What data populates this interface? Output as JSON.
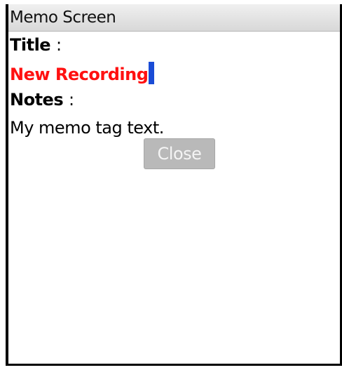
{
  "window": {
    "title": "Memo Screen"
  },
  "form": {
    "title_label": "Title",
    "title_value": "New Recording",
    "notes_label": "Notes",
    "notes_value": "My memo tag text.",
    "colon": ":"
  },
  "buttons": {
    "close_label": "Close"
  },
  "colors": {
    "title_value": "#ff1111",
    "cursor": "#1a4cd6",
    "button_bg": "#b9b9b9",
    "button_text": "#f4f4f4"
  }
}
